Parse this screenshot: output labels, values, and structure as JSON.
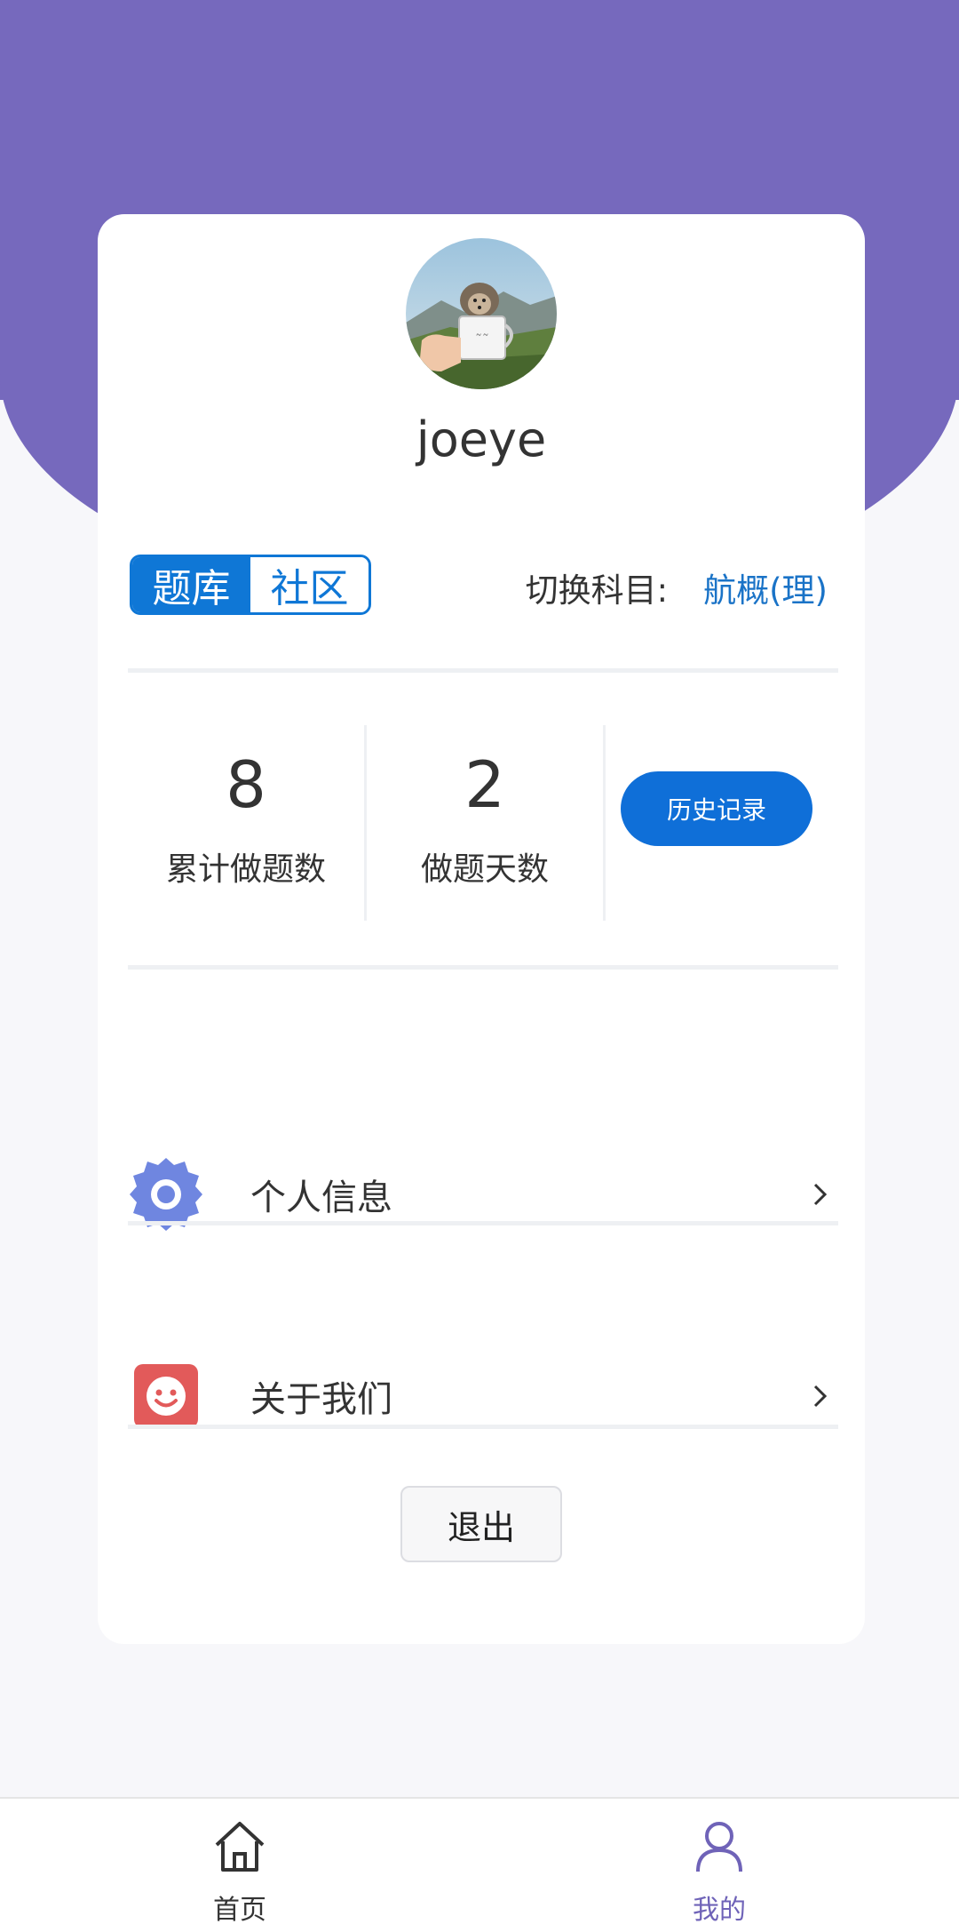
{
  "profile": {
    "username": "joeye",
    "avatar": "hedgehog-in-mug-photo"
  },
  "segment": {
    "tabs": [
      {
        "label": "题库",
        "active": true
      },
      {
        "label": "社区",
        "active": false
      }
    ]
  },
  "subject": {
    "label": "切换科目:",
    "value": "航概(理)"
  },
  "stats": {
    "total_questions": {
      "value": "8",
      "label": "累计做题数"
    },
    "days": {
      "value": "2",
      "label": "做题天数"
    },
    "history_button": "历史记录"
  },
  "menu": [
    {
      "label": "个人信息",
      "icon": "gear-icon"
    },
    {
      "label": "关于我们",
      "icon": "smiley-icon"
    }
  ],
  "logout_label": "退出",
  "tabbar": [
    {
      "label": "首页",
      "icon": "home-icon",
      "active": false
    },
    {
      "label": "我的",
      "icon": "user-icon",
      "active": true
    }
  ],
  "colors": {
    "header": "#7669bd",
    "primary_blue": "#0f77d6",
    "active_tab": "#6f63b8"
  }
}
